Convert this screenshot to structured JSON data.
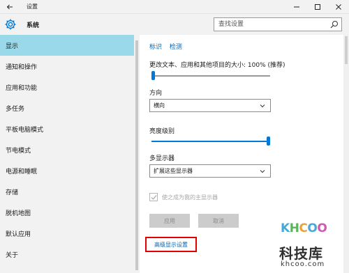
{
  "window": {
    "title": "设置",
    "minimize_icon": "minimize-icon",
    "maximize_icon": "maximize-icon",
    "close_icon": "close-icon"
  },
  "header": {
    "title": "系统",
    "search_placeholder": "查找设置"
  },
  "sidebar": {
    "items": [
      {
        "label": "显示",
        "active": true
      },
      {
        "label": "通知和操作",
        "active": false
      },
      {
        "label": "应用和功能",
        "active": false
      },
      {
        "label": "多任务",
        "active": false
      },
      {
        "label": "平板电脑模式",
        "active": false
      },
      {
        "label": "节电模式",
        "active": false
      },
      {
        "label": "电源和睡眠",
        "active": false
      },
      {
        "label": "存储",
        "active": false
      },
      {
        "label": "脱机地图",
        "active": false
      },
      {
        "label": "默认应用",
        "active": false
      },
      {
        "label": "关于",
        "active": false
      }
    ]
  },
  "content": {
    "link_identify": "标识",
    "link_detect": "检测",
    "scale_label": "更改文本、应用和其他项目的大小: 100% (推荐)",
    "scale_level": 0.0,
    "orientation_label": "方向",
    "orientation_value": "横向",
    "brightness_label": "亮度级别",
    "brightness_level": 1.0,
    "multi_display_label": "多显示器",
    "multi_display_value": "扩展这些显示器",
    "main_display_checkbox": "使之成为我的主显示器",
    "main_display_checked": true,
    "apply_button": "应用",
    "cancel_button": "取消",
    "advanced_link": "高级显示设置"
  },
  "colors": {
    "accent": "#0078d7",
    "sidebar_active": "#99d9ea",
    "highlight_box": "#e30000",
    "link": "#0063b1"
  },
  "watermark": {
    "logo": "KHCOO",
    "cn": "科技库",
    "url": "khcoo.com"
  }
}
